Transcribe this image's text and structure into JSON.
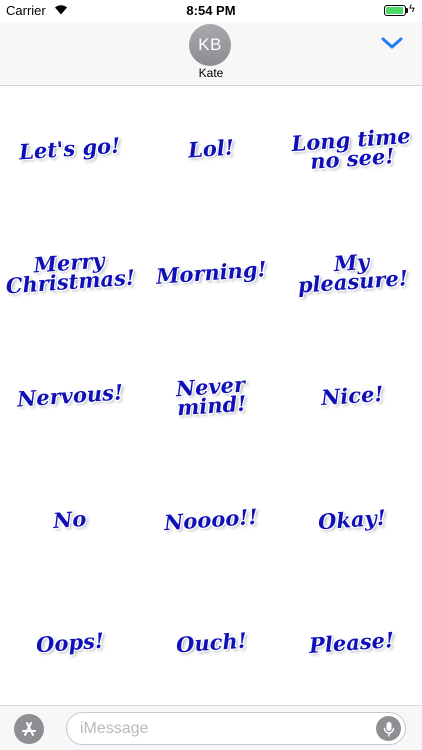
{
  "status_bar": {
    "carrier": "Carrier",
    "time": "8:54 PM",
    "battery_level": 0.92,
    "battery_color": "#4cd964"
  },
  "header": {
    "avatar_initials": "KB",
    "contact_name": "Kate",
    "collapse_icon": "chevron-down-icon",
    "accent_color": "#1e7cf2"
  },
  "stickers": [
    {
      "text": "Let's go!"
    },
    {
      "text": "Lol!"
    },
    {
      "text": "Long time\nno see!"
    },
    {
      "text": "Merry\nChristmas!"
    },
    {
      "text": "Morning!"
    },
    {
      "text": "My\npleasure!"
    },
    {
      "text": "Nervous!"
    },
    {
      "text": "Never mind!"
    },
    {
      "text": "Nice!"
    },
    {
      "text": "No"
    },
    {
      "text": "Noooo!!"
    },
    {
      "text": "Okay!"
    },
    {
      "text": "Oops!"
    },
    {
      "text": "Ouch!"
    },
    {
      "text": "Please!"
    }
  ],
  "sticker_color": "#1010b8",
  "input_bar": {
    "app_icon": "app-store-icon",
    "placeholder": "iMessage",
    "mic_icon": "microphone-icon"
  }
}
